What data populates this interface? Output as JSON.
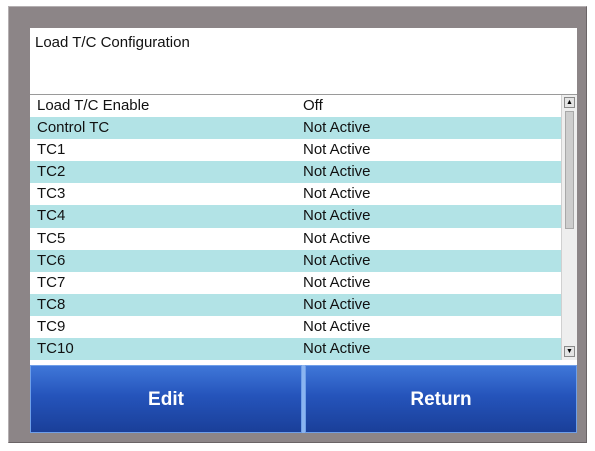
{
  "title": "Load T/C Configuration",
  "rows": [
    {
      "name": "Load T/C Enable",
      "value": "Off"
    },
    {
      "name": "Control TC",
      "value": "Not Active"
    },
    {
      "name": "TC1",
      "value": "Not Active"
    },
    {
      "name": "TC2",
      "value": "Not Active"
    },
    {
      "name": "TC3",
      "value": "Not Active"
    },
    {
      "name": "TC4",
      "value": "Not Active"
    },
    {
      "name": "TC5",
      "value": "Not Active"
    },
    {
      "name": "TC6",
      "value": "Not Active"
    },
    {
      "name": "TC7",
      "value": "Not Active"
    },
    {
      "name": "TC8",
      "value": "Not Active"
    },
    {
      "name": "TC9",
      "value": "Not Active"
    },
    {
      "name": "TC10",
      "value": "Not Active"
    }
  ],
  "buttons": {
    "edit_label": "Edit",
    "return_label": "Return"
  },
  "colors": {
    "row_alt": "#b2e3e6",
    "button_blue": "#2554bb",
    "bezel": "#8c8587"
  },
  "icons": {
    "scroll_up": "scroll-up-arrow-icon",
    "scroll_down": "scroll-down-arrow-icon"
  }
}
